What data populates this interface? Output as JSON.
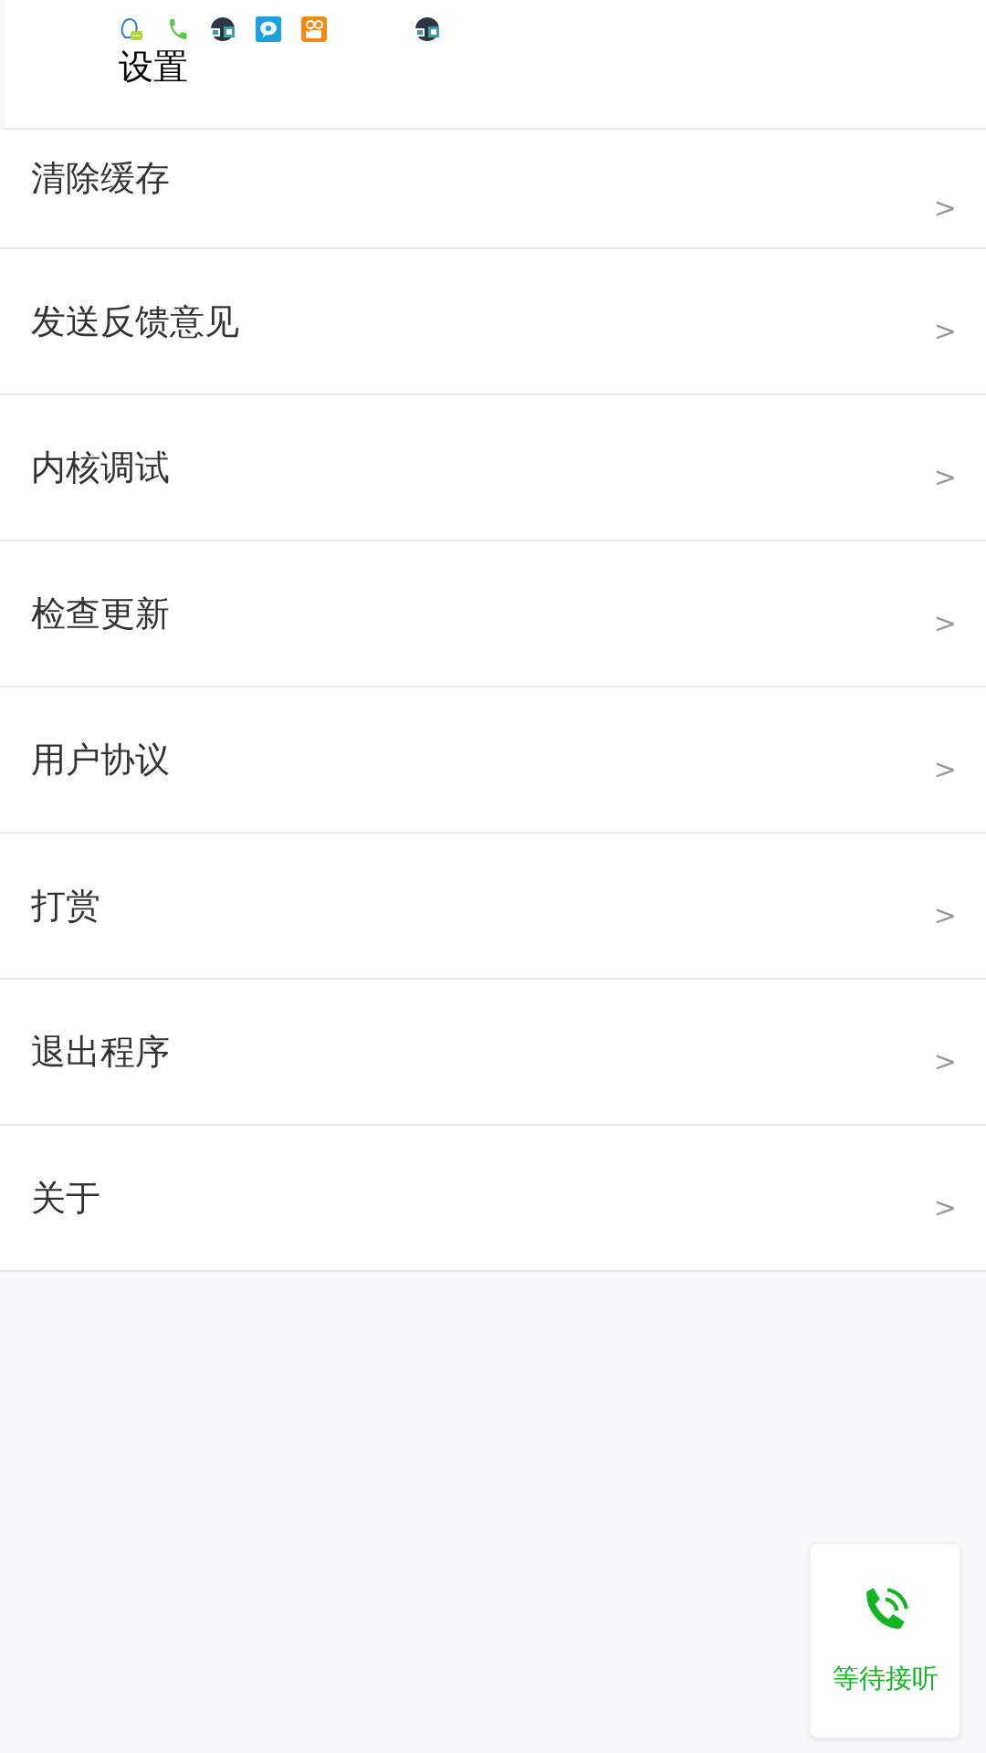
{
  "status_bar": {
    "icons": [
      {
        "kind": "chat"
      },
      {
        "kind": "phone"
      },
      {
        "kind": "cast"
      },
      {
        "kind": "bubble"
      },
      {
        "kind": "video"
      },
      {
        "kind": "gap"
      },
      {
        "kind": "cast"
      }
    ]
  },
  "header": {
    "title": "设置"
  },
  "menu": [
    {
      "label": "清除缓存",
      "arrow": ">"
    },
    {
      "label": "发送反馈意见",
      "arrow": ">"
    },
    {
      "label": "内核调试",
      "arrow": ">"
    },
    {
      "label": "检查更新",
      "arrow": ">"
    },
    {
      "label": "用户协议",
      "arrow": ">"
    },
    {
      "label": "打赏",
      "arrow": ">"
    },
    {
      "label": "退出程序",
      "arrow": ">"
    },
    {
      "label": "关于",
      "arrow": ">"
    }
  ],
  "call_button": {
    "label": "等待接听"
  }
}
